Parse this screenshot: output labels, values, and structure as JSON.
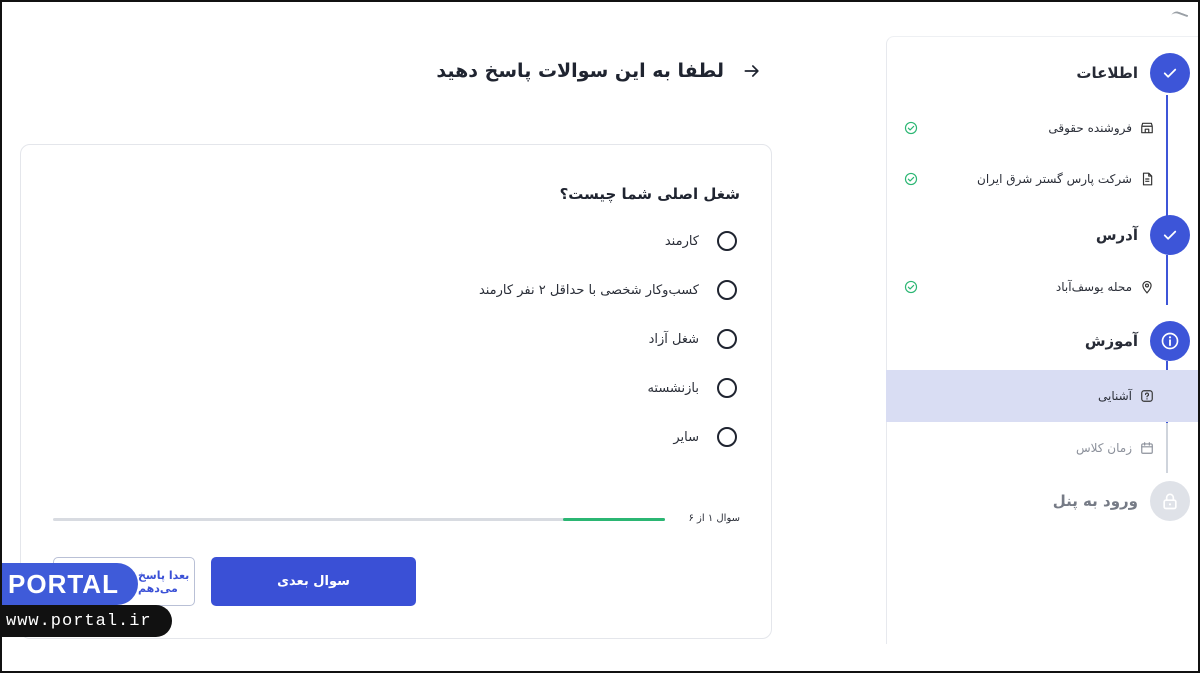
{
  "page": {
    "title": "لطفا به این سوالات پاسخ دهید"
  },
  "stepper": {
    "steps": [
      {
        "title": "اطلاعات",
        "status": "done",
        "items": [
          {
            "label": "فروشنده حقوقی",
            "icon": "store-icon",
            "completed": true
          },
          {
            "label": "شرکت پارس گستر شرق ایران",
            "icon": "document-icon",
            "completed": true
          }
        ]
      },
      {
        "title": "آدرس",
        "status": "done",
        "items": [
          {
            "label": "محله یوسف‌آباد",
            "icon": "location-pin-icon",
            "completed": true
          }
        ]
      },
      {
        "title": "آموزش",
        "status": "current",
        "items": [
          {
            "label": "آشنایی",
            "icon": "question-icon",
            "selected": true
          },
          {
            "label": "زمان کلاس",
            "icon": "calendar-icon",
            "selected": false
          }
        ]
      },
      {
        "title": "ورود به پنل",
        "status": "locked",
        "items": []
      }
    ]
  },
  "question": {
    "text": "شغل اصلی شما چیست؟",
    "options": [
      "کارمند",
      "کسب‌وکار شخصی با حداقل ۲ نفر کارمند",
      "شغل آزاد",
      "بازنشسته",
      "سایر"
    ]
  },
  "progress": {
    "label": "سوال ۱ از ۶",
    "current": 1,
    "total": 6
  },
  "buttons": {
    "next": "سوال بعدی",
    "later": "بعدا پاسخ می‌دهم"
  },
  "watermark": {
    "brand": "PORTAL",
    "url": "www.portal.ir"
  },
  "colors": {
    "primary": "#3a50d6",
    "success": "#2bb673",
    "selected_bg": "#d9ddf3"
  }
}
